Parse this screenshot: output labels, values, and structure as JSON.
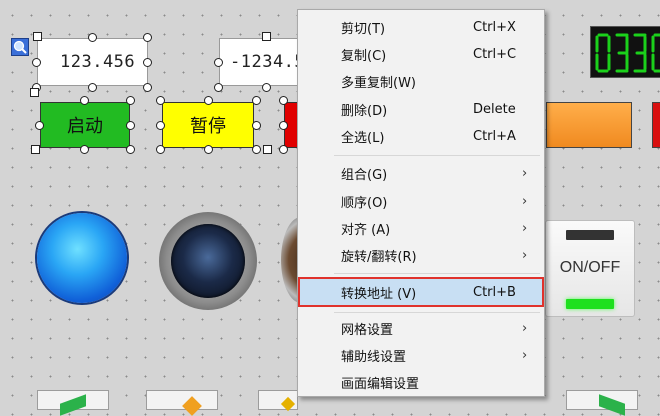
{
  "canvas": {
    "numeric_display_1": "123.456",
    "numeric_display_2": "-1234.5",
    "start_button_label": "启动",
    "pause_button_label": "暂停",
    "onoff_label": "ON/OFF"
  },
  "menu": {
    "items": [
      {
        "label": "剪切(T)",
        "shortcut": "Ctrl+X",
        "submenu": false
      },
      {
        "label": "复制(C)",
        "shortcut": "Ctrl+C",
        "submenu": false
      },
      {
        "label": "多重复制(W)",
        "shortcut": "",
        "submenu": false
      },
      {
        "label": "删除(D)",
        "shortcut": "Delete",
        "submenu": false
      },
      {
        "label": "全选(L)",
        "shortcut": "Ctrl+A",
        "submenu": false
      },
      {
        "label": "组合(G)",
        "shortcut": "",
        "submenu": true
      },
      {
        "label": "顺序(O)",
        "shortcut": "",
        "submenu": true
      },
      {
        "label": "对齐 (A)",
        "shortcut": "",
        "submenu": true
      },
      {
        "label": "旋转/翻转(R)",
        "shortcut": "",
        "submenu": true
      },
      {
        "label": "转换地址 (V)",
        "shortcut": "Ctrl+B",
        "submenu": false
      },
      {
        "label": "网格设置",
        "shortcut": "",
        "submenu": true
      },
      {
        "label": "辅助线设置",
        "shortcut": "",
        "submenu": true
      },
      {
        "label": "画面编辑设置",
        "shortcut": "",
        "submenu": false
      }
    ],
    "arrow_glyph": "›"
  },
  "colors": {
    "start_button": "#22bb22",
    "pause_button": "#ffff00",
    "highlight_bg": "#c8dff3",
    "highlight_border": "#e0322c",
    "orange_button": "#f08a20"
  }
}
